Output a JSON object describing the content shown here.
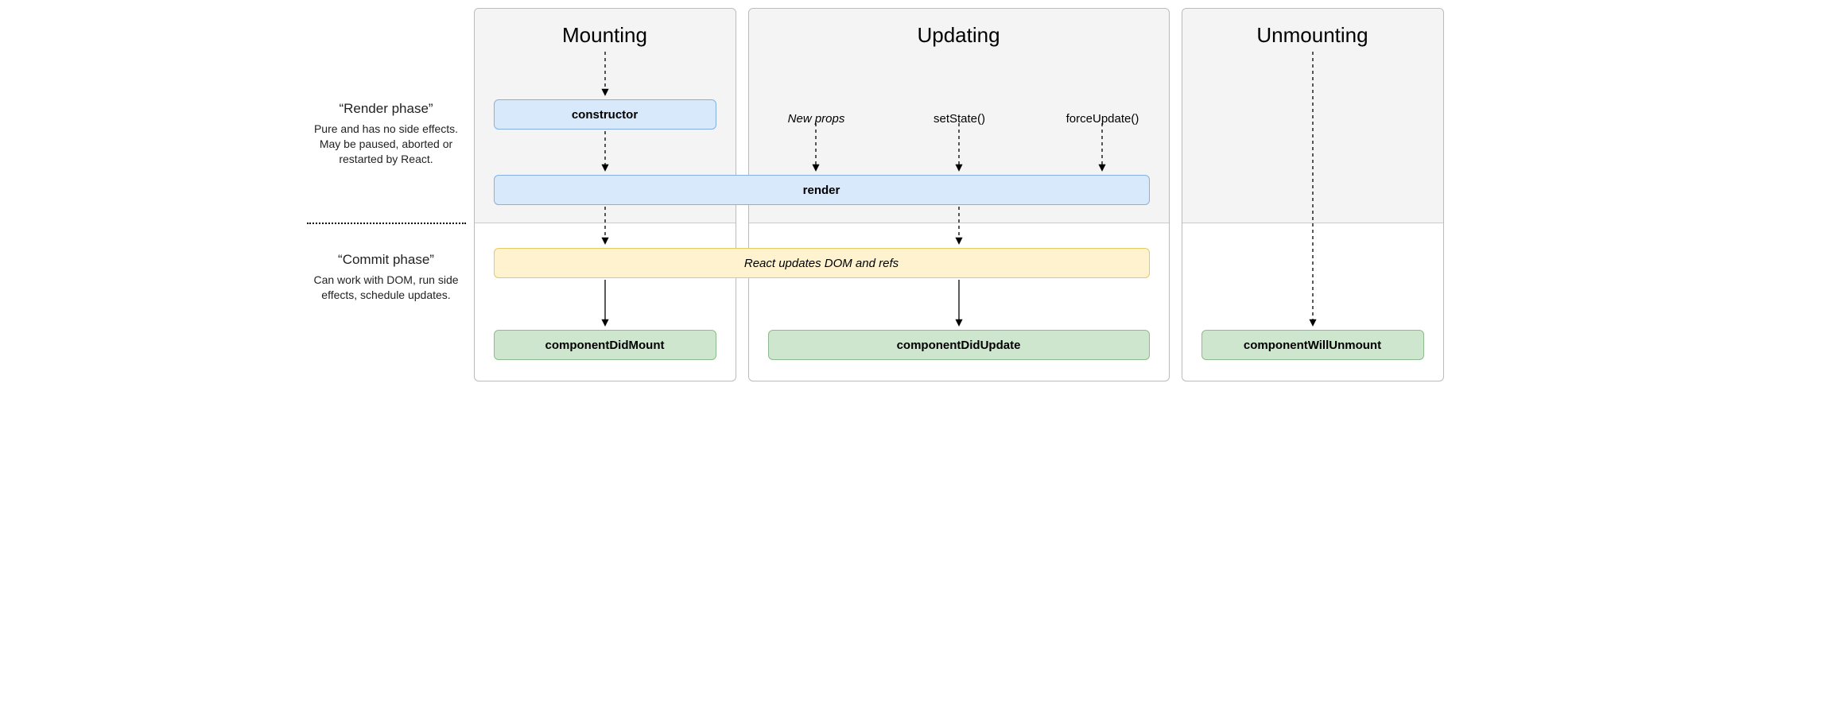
{
  "phases": {
    "render": {
      "title": "“Render phase”",
      "desc": "Pure and has no side effects. May be paused, aborted or restarted by React."
    },
    "commit": {
      "title": "“Commit phase”",
      "desc": "Can work with DOM, run side effects, schedule updates."
    }
  },
  "columns": {
    "mounting": {
      "title": "Mounting"
    },
    "updating": {
      "title": "Updating",
      "triggers": {
        "newProps": "New props",
        "setState": "setState()",
        "forceUpdate": "forceUpdate()"
      }
    },
    "unmounting": {
      "title": "Unmounting"
    }
  },
  "nodes": {
    "constructor": "constructor",
    "render": "render",
    "domRefs": "React updates DOM and refs",
    "didMount": "componentDidMount",
    "didUpdate": "componentDidUpdate",
    "willUnmount": "componentWillUnmount"
  }
}
